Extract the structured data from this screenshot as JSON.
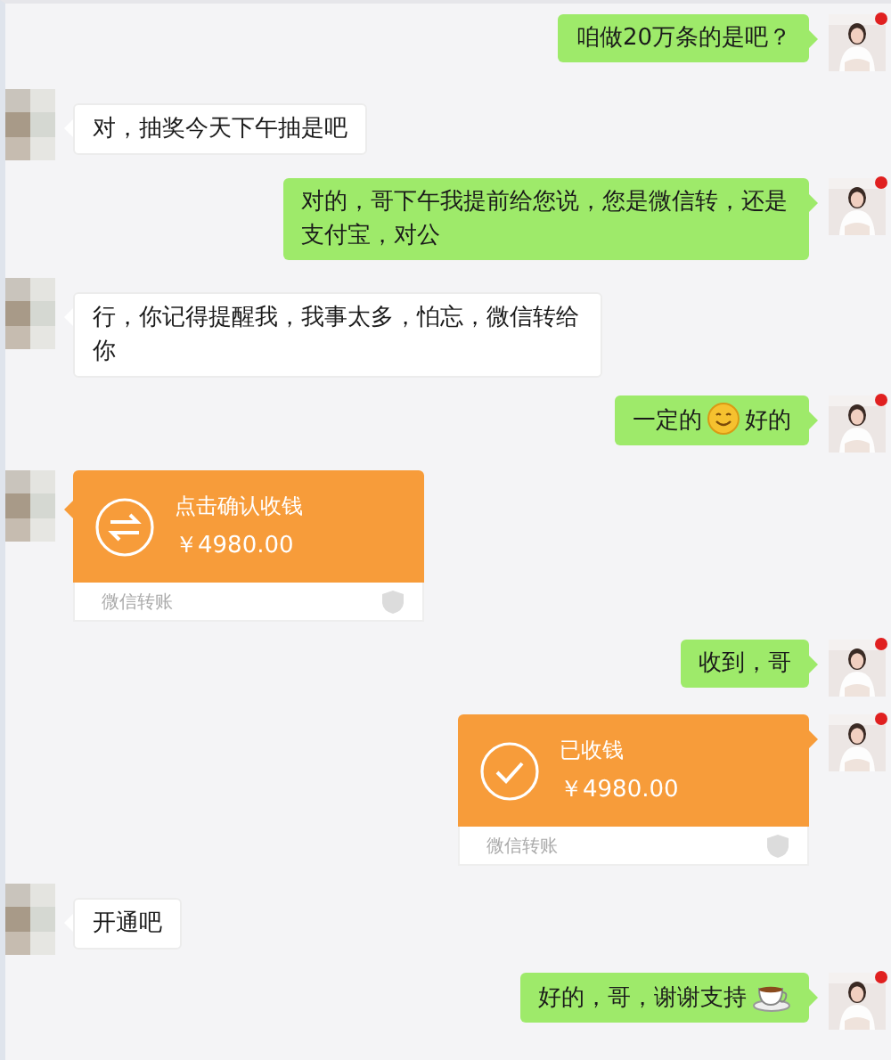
{
  "messages": [
    {
      "sent": true,
      "badge": true,
      "kind": "text",
      "parts": [
        {
          "kind": "text",
          "text": "咱做20万条的是吧？"
        }
      ]
    },
    {
      "sent": false,
      "kind": "text",
      "parts": [
        {
          "kind": "text",
          "text": "对，抽奖今天下午抽是吧"
        }
      ]
    },
    {
      "sent": true,
      "badge": true,
      "kind": "text",
      "parts": [
        {
          "kind": "text",
          "text": "对的，哥下午我提前给您说，您是微信转，还是支付宝，对公"
        }
      ]
    },
    {
      "sent": false,
      "kind": "text",
      "parts": [
        {
          "kind": "text",
          "text": "行，你记得提醒我，我事太多，怕忘，微信转给你"
        }
      ]
    },
    {
      "sent": true,
      "badge": true,
      "kind": "text",
      "parts": [
        {
          "kind": "text",
          "text": "一定的"
        },
        {
          "kind": "smiley"
        },
        {
          "kind": "text",
          "text": "好的"
        }
      ]
    },
    {
      "sent": false,
      "kind": "transfer",
      "received": false,
      "status": "点击确认收钱",
      "amount": "￥4980.00",
      "footer": "微信转账"
    },
    {
      "sent": true,
      "badge": true,
      "kind": "text",
      "parts": [
        {
          "kind": "text",
          "text": "收到，哥"
        }
      ]
    },
    {
      "sent": true,
      "badge": true,
      "kind": "transfer",
      "received": true,
      "status": "已收钱",
      "amount": "￥4980.00",
      "footer": "微信转账"
    },
    {
      "sent": false,
      "kind": "text",
      "parts": [
        {
          "kind": "text",
          "text": "开通吧"
        }
      ]
    },
    {
      "sent": true,
      "badge": true,
      "kind": "text",
      "parts": [
        {
          "kind": "text",
          "text": "好的，哥，谢谢支持"
        },
        {
          "kind": "tea"
        }
      ]
    }
  ]
}
